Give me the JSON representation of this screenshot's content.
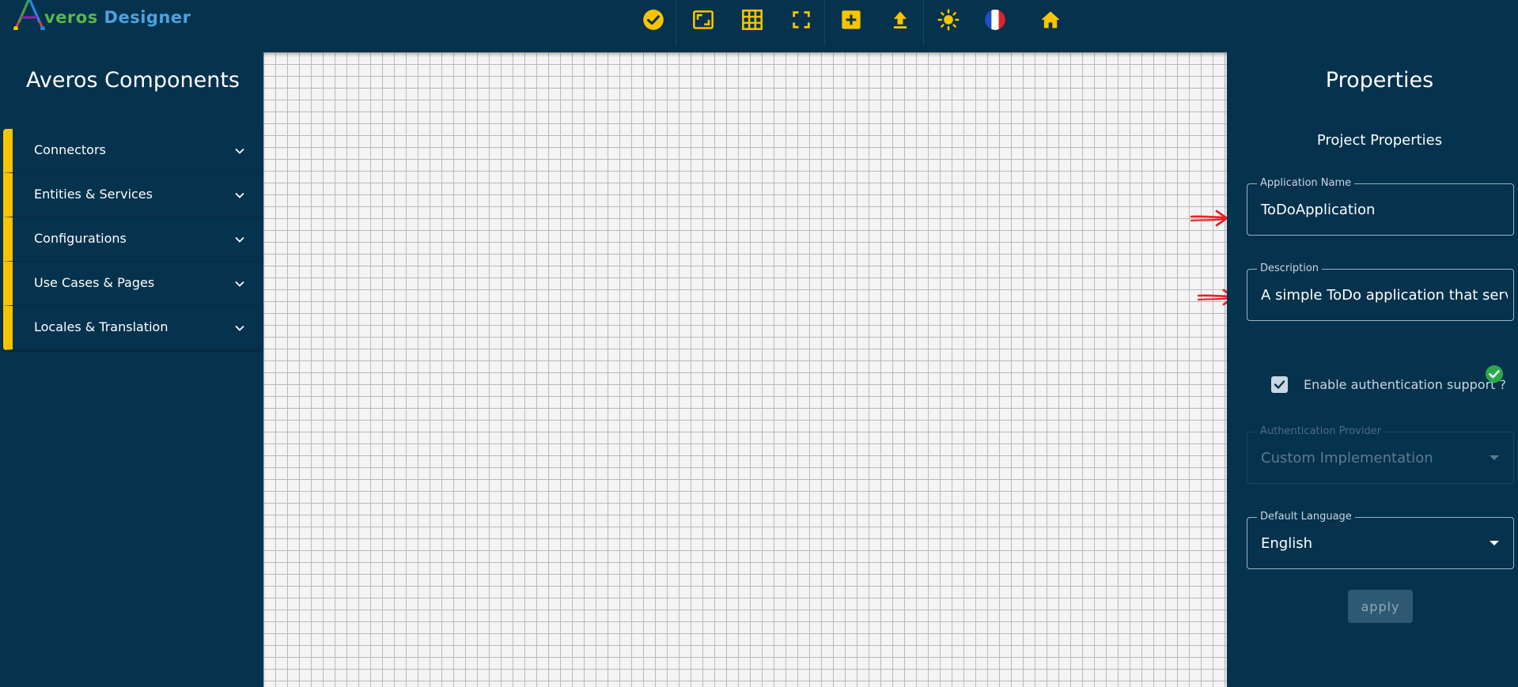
{
  "app": {
    "logo_letter": "A",
    "logo_word1": "veros",
    "logo_word2": "Designer"
  },
  "toolbar": {
    "icons": [
      {
        "name": "validate-check-icon"
      },
      {
        "name": "fit-view-icon"
      },
      {
        "name": "grid-toggle-icon"
      },
      {
        "name": "fullscreen-icon"
      },
      {
        "name": "add-icon"
      },
      {
        "name": "upload-icon"
      },
      {
        "name": "theme-sun-icon"
      },
      {
        "name": "french-flag-icon"
      },
      {
        "name": "home-icon"
      }
    ],
    "accent_color": "#f8c300"
  },
  "sidebar": {
    "title": "Averos Components",
    "items": [
      {
        "label": "Connectors"
      },
      {
        "label": "Entities & Services"
      },
      {
        "label": "Configurations"
      },
      {
        "label": "Use Cases & Pages"
      },
      {
        "label": "Locales & Translation"
      }
    ]
  },
  "properties": {
    "title": "Properties",
    "subtitle": "Project Properties",
    "app_name": {
      "label": "Application Name",
      "value": "ToDoApplication"
    },
    "description": {
      "label": "Description",
      "value": "A simple ToDo application that serv"
    },
    "auth": {
      "label": "Enable authentication support ?",
      "checked": true
    },
    "auth_provider": {
      "label": "Authentication Provider",
      "value": "Custom Implementation"
    },
    "default_language": {
      "label": "Default Language",
      "value": "English"
    },
    "apply_label": "apply"
  },
  "colors": {
    "background": "#05324d",
    "accent": "#f8c300",
    "canvas": "#f4f4f4",
    "annotation_arrow": "#e8202a",
    "valid": "#2aa84a"
  }
}
